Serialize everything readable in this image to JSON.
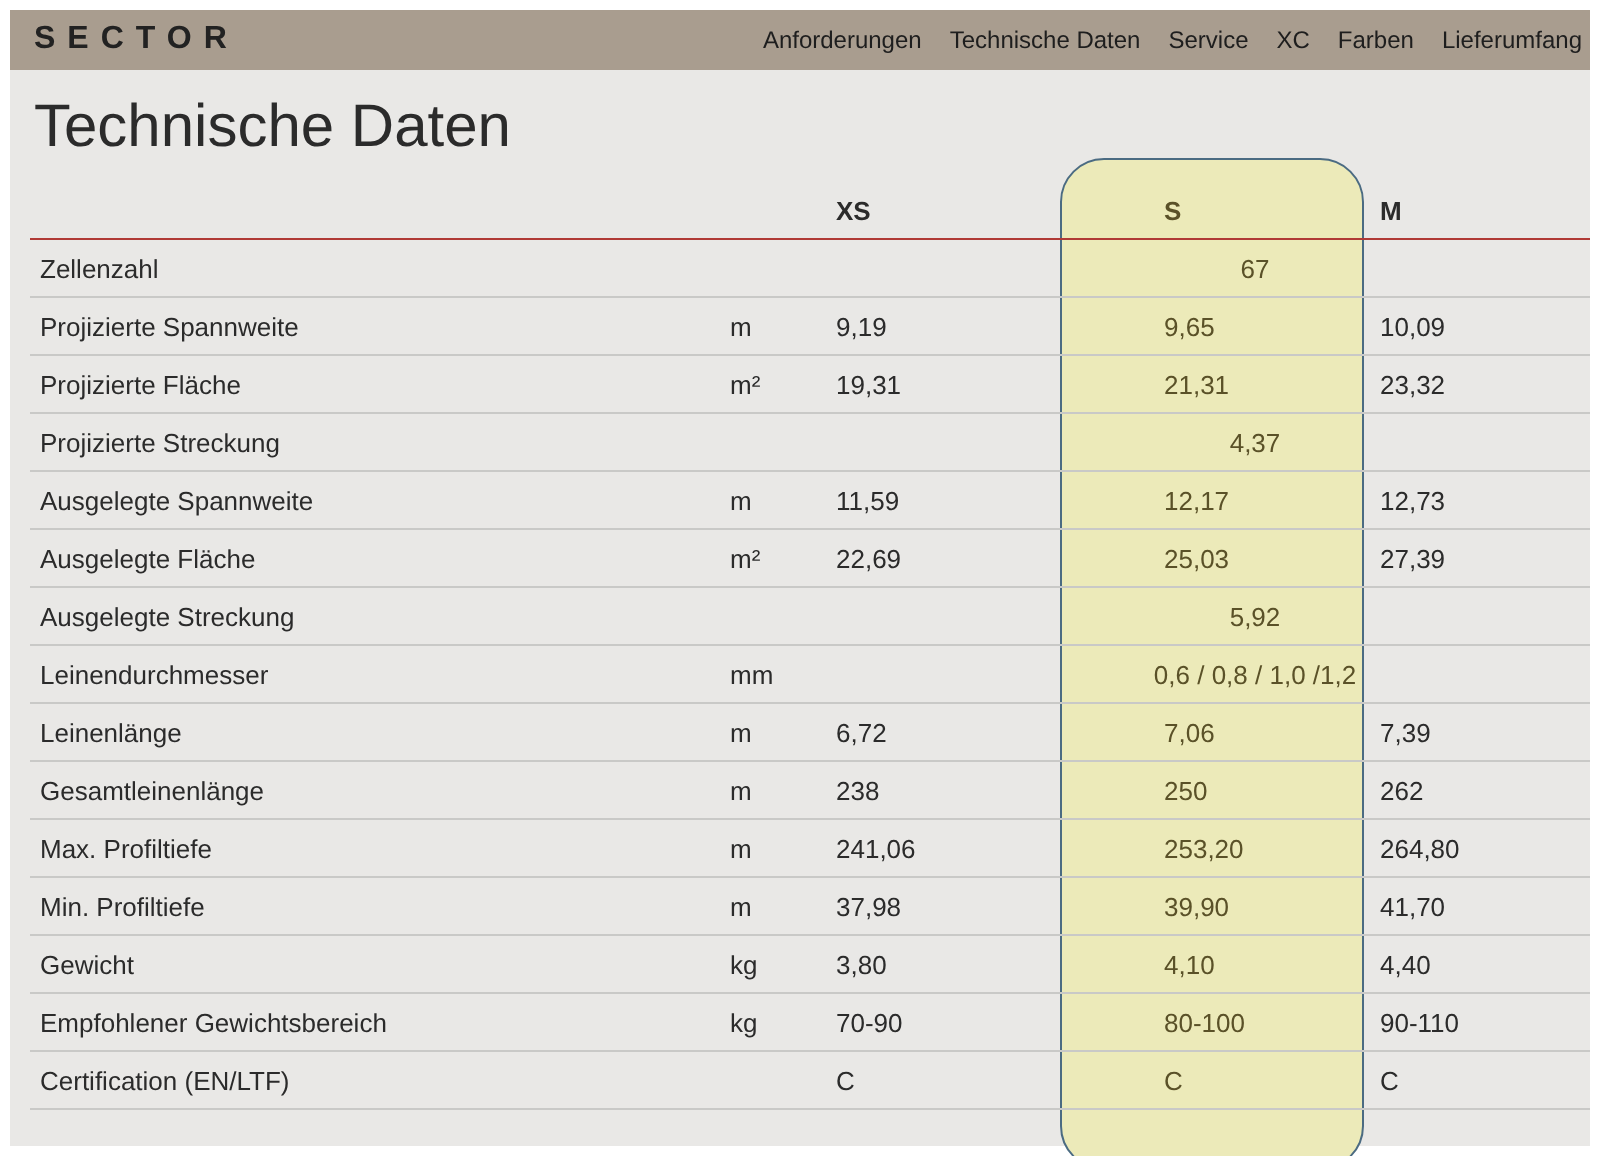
{
  "brand": {
    "logo": "SECTOR"
  },
  "nav": [
    "Anforderungen",
    "Technische Daten",
    "Service",
    "XC",
    "Farben",
    "Lieferumfang"
  ],
  "title": "Technische Daten",
  "sizes": [
    {
      "label": "XS",
      "selected": false
    },
    {
      "label": "S",
      "selected": true
    },
    {
      "label": "M",
      "selected": false
    }
  ],
  "rows": [
    {
      "kind": "shared",
      "label": "Zellenzahl",
      "value": "67"
    },
    {
      "kind": "per_size",
      "label": "Projizierte Spannweite",
      "unit": "m",
      "values": [
        "9,19",
        "9,65",
        "10,09"
      ]
    },
    {
      "kind": "per_size",
      "label": "Projizierte Fläche",
      "unit": "m²",
      "values": [
        "19,31",
        "21,31",
        "23,32"
      ]
    },
    {
      "kind": "shared",
      "label": "Projizierte Streckung",
      "value": "4,37"
    },
    {
      "kind": "per_size",
      "label": "Ausgelegte Spannweite",
      "unit": "m",
      "values": [
        "11,59",
        "12,17",
        "12,73"
      ]
    },
    {
      "kind": "per_size",
      "label": "Ausgelegte Fläche",
      "unit": "m²",
      "values": [
        "22,69",
        "25,03",
        "27,39"
      ]
    },
    {
      "kind": "shared",
      "label": "Ausgelegte Streckung",
      "value": "5,92"
    },
    {
      "kind": "shared",
      "label": "Leinendurchmesser",
      "unit": "mm",
      "value": "0,6 / 0,8 / 1,0 /1,2"
    },
    {
      "kind": "per_size",
      "label": "Leinenlänge",
      "unit": "m",
      "values": [
        "6,72",
        "7,06",
        "7,39"
      ]
    },
    {
      "kind": "per_size",
      "label": "Gesamtleinenlänge",
      "unit": "m",
      "values": [
        "238",
        "250",
        "262"
      ]
    },
    {
      "kind": "per_size",
      "label": "Max. Profiltiefe",
      "unit": "m",
      "values": [
        "241,06",
        "253,20",
        "264,80"
      ]
    },
    {
      "kind": "per_size",
      "label": "Min. Profiltiefe",
      "unit": "m",
      "values": [
        "37,98",
        "39,90",
        "41,70"
      ]
    },
    {
      "kind": "per_size",
      "label": "Gewicht",
      "unit": "kg",
      "values": [
        "3,80",
        "4,10",
        "4,40"
      ]
    },
    {
      "kind": "per_size",
      "label": "Empfohlener Gewichtsbereich",
      "unit": "kg",
      "values": [
        "70-90",
        "80-100",
        "90-110"
      ]
    },
    {
      "kind": "per_size",
      "label": "Certification (EN/LTF)",
      "values": [
        "C",
        "C",
        "C"
      ]
    }
  ]
}
